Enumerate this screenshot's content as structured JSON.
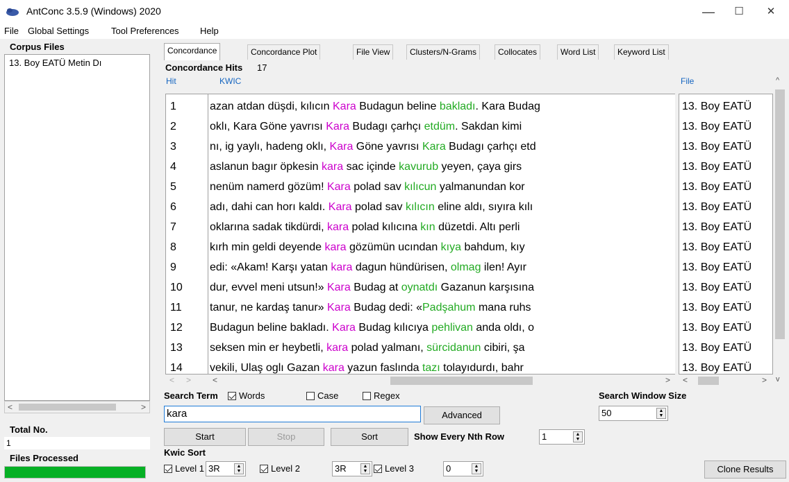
{
  "window": {
    "title": "AntConc 3.5.9 (Windows) 2020",
    "minimize": "—",
    "maximize": "☐",
    "close": "✕"
  },
  "menu": [
    "File",
    "Global Settings",
    "Tool Preferences",
    "Help"
  ],
  "left": {
    "corpus_files_label": "Corpus Files",
    "corpus_files": [
      "13. Boy EATÜ Metin Dı"
    ],
    "total_no_label": "Total No.",
    "total_no_value": "1",
    "files_processed_label": "Files Processed",
    "progress": 1.0
  },
  "tabs": [
    "Concordance",
    "Concordance Plot",
    "File View",
    "Clusters/N-Grams",
    "Collocates",
    "Word List",
    "Keyword List"
  ],
  "active_tab": 0,
  "hits": {
    "label": "Concordance Hits",
    "count": "17"
  },
  "columns": {
    "hit": "Hit",
    "kwic": "KWIC",
    "file": "File"
  },
  "rows": [
    {
      "hit": "1",
      "left": "azan atdan düşdi, kılıcın ",
      "kw": "Kara",
      "mid": " Budagun beline ",
      "coll": "bakladı",
      "right": ". Kara Budag",
      "file": "13. Boy EATÜ"
    },
    {
      "hit": "2",
      "left": " oklı, Kara Göne yavrısı ",
      "kw": "Kara",
      "mid": " Budagı çarhçı ",
      "coll": "etdüm",
      "right": ".  Sakdan kimi",
      "file": "13. Boy EATÜ"
    },
    {
      "hit": "3",
      "left": "nı, ig yaylı, hadeng oklı, ",
      "kw": "Kara",
      "mid": " Göne yavrısı ",
      "coll": "Kara",
      "right": " Budagı çarhçı etd",
      "file": "13. Boy EATÜ"
    },
    {
      "hit": "4",
      "left": " aslanun  bagır öpkesin ",
      "kw": "kara",
      "mid": " sac içinde ",
      "coll": "kavurub",
      "right": " yeyen, çaya girs",
      "file": "13. Boy EATÜ"
    },
    {
      "hit": "5",
      "left": "nenüm namerd gözüm! ",
      "kw": "Kara",
      "mid": " polad sav ",
      "coll": "kılıcun",
      "right": " yalmanundan kor",
      "file": "13. Boy EATÜ"
    },
    {
      "hit": "6",
      "left": "adı, dahi can horı kaldı. ",
      "kw": "Kara",
      "mid": " polad sav ",
      "coll": "kılıcın",
      "right": " eline aldı, sıyıra kılı",
      "file": "13. Boy EATÜ"
    },
    {
      "hit": "7",
      "left": "oklarına sadak tikdürdi, ",
      "kw": "kara",
      "mid": " polad kılıcına ",
      "coll": "kın",
      "right": " düzetdi. Altı perli",
      "file": "13. Boy EATÜ"
    },
    {
      "hit": "8",
      "left": " kırh min geldi deyende ",
      "kw": "kara",
      "mid": " gözümün ucından ",
      "coll": "kıya",
      "right": " bahdum, kıy",
      "file": "13. Boy EATÜ"
    },
    {
      "hit": "9",
      "left": "edi: «Akam! Karşı yatan ",
      "kw": "kara",
      "mid": " dagun hündürisen, ",
      "coll": "olmag",
      "right": " ilen! Ayır",
      "file": "13. Boy EATÜ"
    },
    {
      "hit": "10",
      "left": "dur, evvel meni utsun!» ",
      "kw": "Kara",
      "mid": " Budag at ",
      "coll": "oynatdı",
      "right": " Gazanun karşısına",
      "file": "13. Boy EATÜ"
    },
    {
      "hit": "11",
      "left": "tanur, ne kardaş tanur» ",
      "kw": "Kara",
      "mid": " Budag dedi: «",
      "coll": "Padşahum",
      "right": " mana ruhs",
      "file": "13. Boy EATÜ"
    },
    {
      "hit": "12",
      "left": "Budagun beline bakladı. ",
      "kw": "Kara",
      "mid": " Budag kılıcıya ",
      "coll": "pehlivan",
      "right": " anda oldı, o",
      "file": "13. Boy EATÜ"
    },
    {
      "hit": "13",
      "left": " seksen min er heybetli, ",
      "kw": "kara",
      "mid": " polad yalmanı, ",
      "coll": "sürcidanun",
      "right": " cibiri, şa",
      "file": "13. Boy EATÜ"
    },
    {
      "hit": "14",
      "left": " vekili, Ulaş oglı  Gazan ",
      "kw": "kara",
      "mid": " yazun faslında ",
      "coll": "tazı",
      "right": " tolayıdurdı, bahr",
      "file": "13. Boy EATÜ"
    }
  ],
  "search": {
    "term_label": "Search Term",
    "words_label": "Words",
    "words_checked": true,
    "case_label": "Case",
    "case_checked": false,
    "regex_label": "Regex",
    "regex_checked": false,
    "value": "kara",
    "advanced_label": "Advanced",
    "window_size_label": "Search Window Size",
    "window_size": "50"
  },
  "actions": {
    "start": "Start",
    "stop": "Stop",
    "sort": "Sort"
  },
  "nth_row": {
    "label": "Show Every Nth Row",
    "value": "1"
  },
  "kwic_sort": {
    "label": "Kwic Sort",
    "level1_label": "Level 1",
    "level1": "3R",
    "level2_label": "Level 2",
    "level2": "3R",
    "level3_label": "Level 3",
    "level3": "0"
  },
  "clone_results": "Clone Results",
  "colors": {
    "keyword": "#cc00cc",
    "collocate": "#22aa22",
    "progress": "#06b025",
    "header_link": "#1565c0"
  }
}
